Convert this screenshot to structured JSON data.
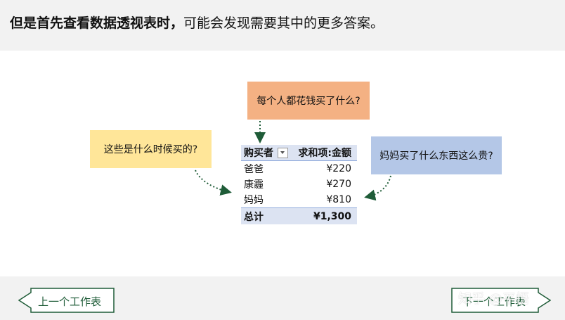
{
  "header": {
    "bold_text": "但是首先查看数据透视表时，",
    "normal_text": "可能会发现需要其中的更多答案。"
  },
  "notes": {
    "top": "每个人都花钱买了什么?",
    "left": "这些是什么时候买的?",
    "right": "妈妈买了什么东西这么贵?"
  },
  "pivot": {
    "col_buyer": "购买者",
    "col_sum": "求和项:金额",
    "rows": [
      {
        "name": "爸爸",
        "amount": "¥220"
      },
      {
        "name": "康霾",
        "amount": "¥270"
      },
      {
        "name": "妈妈",
        "amount": "¥810"
      }
    ],
    "total_label": "总计",
    "total_amount": "¥1,300"
  },
  "nav": {
    "prev": "上一个工作表",
    "next": "下一个工作表"
  },
  "watermark": "知乎 @平悟",
  "colors": {
    "orange_note": "#f4b183",
    "yellow_note": "#ffe699",
    "blue_note": "#b4c7e7",
    "accent_green": "#1f5c38"
  }
}
